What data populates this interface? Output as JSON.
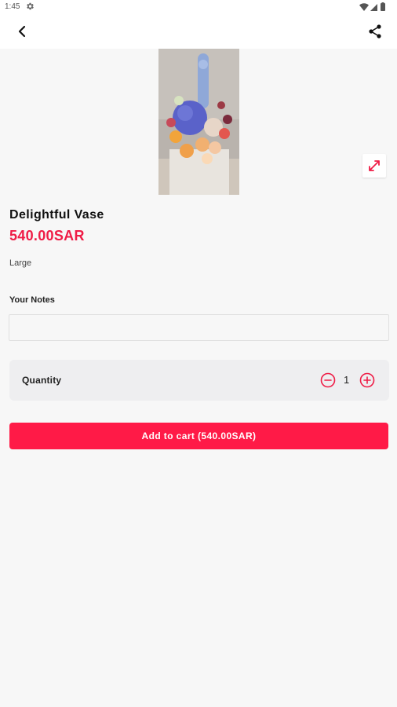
{
  "status_bar": {
    "time": "1:45"
  },
  "product": {
    "name": "Delightful Vase",
    "price": "540.00SAR",
    "size": "Large"
  },
  "notes": {
    "label": "Your Notes",
    "value": "",
    "placeholder": ""
  },
  "quantity": {
    "label": "Quantity",
    "value": "1"
  },
  "cart": {
    "button_label": "Add to cart (540.00SAR)"
  },
  "colors": {
    "accent": "#ff1a47",
    "price": "#ef1c46",
    "background": "#f7f7f7"
  },
  "icons": [
    "settings-icon",
    "wifi-icon",
    "signal-icon",
    "battery-icon",
    "back-arrow-icon",
    "share-icon",
    "expand-icon",
    "minus-circle-icon",
    "plus-circle-icon"
  ]
}
